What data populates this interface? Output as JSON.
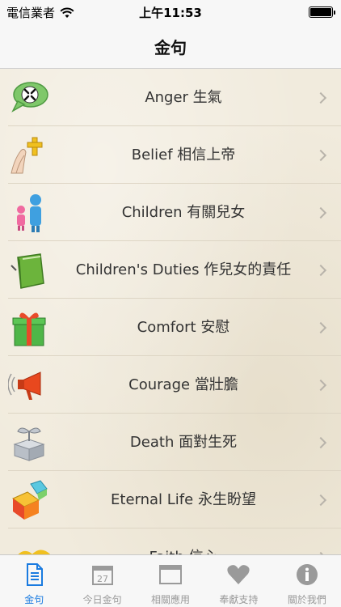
{
  "status": {
    "carrier": "電信業者",
    "time": "上午11:53"
  },
  "nav": {
    "title": "金句"
  },
  "items": [
    {
      "label": "Anger 生氣"
    },
    {
      "label": "Belief 相信上帝"
    },
    {
      "label": "Children 有關兒女"
    },
    {
      "label": "Children's Duties 作兒女的責任"
    },
    {
      "label": "Comfort 安慰"
    },
    {
      "label": "Courage 當壯膽"
    },
    {
      "label": "Death 面對生死"
    },
    {
      "label": "Eternal Life 永生盼望"
    },
    {
      "label": "Faith 信心"
    }
  ],
  "tabs": [
    {
      "label": "金句",
      "icon": "document-icon",
      "active": true
    },
    {
      "label": "今日金句",
      "icon": "calendar-icon",
      "day": "27"
    },
    {
      "label": "相關應用",
      "icon": "window-icon"
    },
    {
      "label": "奉獻支持",
      "icon": "heart-icon"
    },
    {
      "label": "關於我們",
      "icon": "info-icon"
    }
  ],
  "colors": {
    "accent": "#1a7be0",
    "inactive": "#9a9a9a"
  }
}
